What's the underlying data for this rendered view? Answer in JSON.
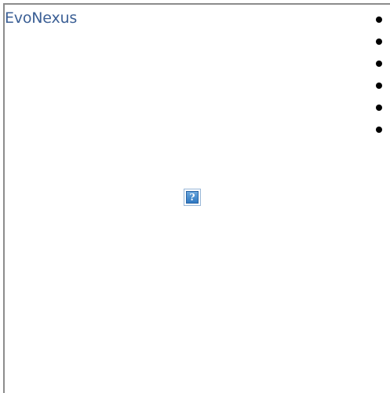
{
  "brand": {
    "title": "EvoNexus"
  },
  "nav": {
    "items": [
      {
        "label": ""
      },
      {
        "label": ""
      },
      {
        "label": ""
      },
      {
        "label": ""
      },
      {
        "label": ""
      },
      {
        "label": ""
      }
    ]
  },
  "main_image": {
    "icon": "broken-image-icon",
    "glyph": "?"
  },
  "colors": {
    "link": "#3b5f95",
    "frame_border": "#8c8c8c",
    "bullet": "#000000",
    "placeholder_fill": "#2f78c2"
  }
}
